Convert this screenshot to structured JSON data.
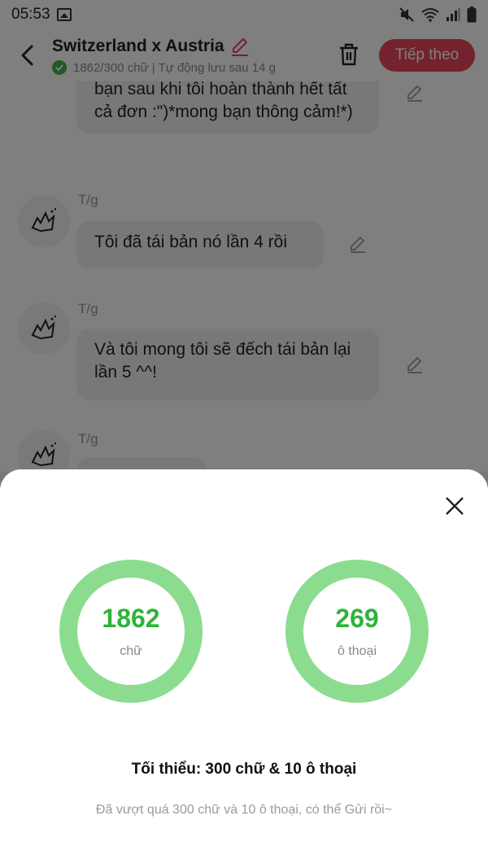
{
  "status_bar": {
    "time": "05:53",
    "icons": [
      "image-icon",
      "mute-icon",
      "wifi-icon",
      "signal-icon",
      "battery-icon"
    ]
  },
  "header": {
    "title": "Switzerland x Austria",
    "subtitle": "1862/300 chữ | Tự động lưu sau 14 g",
    "next_label": "Tiếp theo",
    "accent_color": "#e8455a"
  },
  "chat": {
    "messages": [
      {
        "sender": "",
        "text": "bạn sau khi tôi hoàn thành hết tất cả đơn :\")*mong bạn thông cảm!*)"
      },
      {
        "sender": "T/g",
        "text": "Tôi đã tái bản nó lần 4 rồi"
      },
      {
        "sender": "T/g",
        "text": "Và tôi mong tôi sẽ đếch tái bản lại lần 5 ^^!"
      },
      {
        "sender": "T/g",
        "text": ""
      }
    ]
  },
  "sheet": {
    "stats": [
      {
        "value": "1862",
        "unit": "chữ"
      },
      {
        "value": "269",
        "unit": "ô thoại"
      }
    ],
    "minimum": "Tối thiểu: 300 chữ & 10 ô thoại",
    "note": "Đã vượt quá 300 chữ và 10 ô thoại, có thể Gửi rồi~",
    "ring_color": "#8bdc8f",
    "value_color": "#2fb33a"
  }
}
